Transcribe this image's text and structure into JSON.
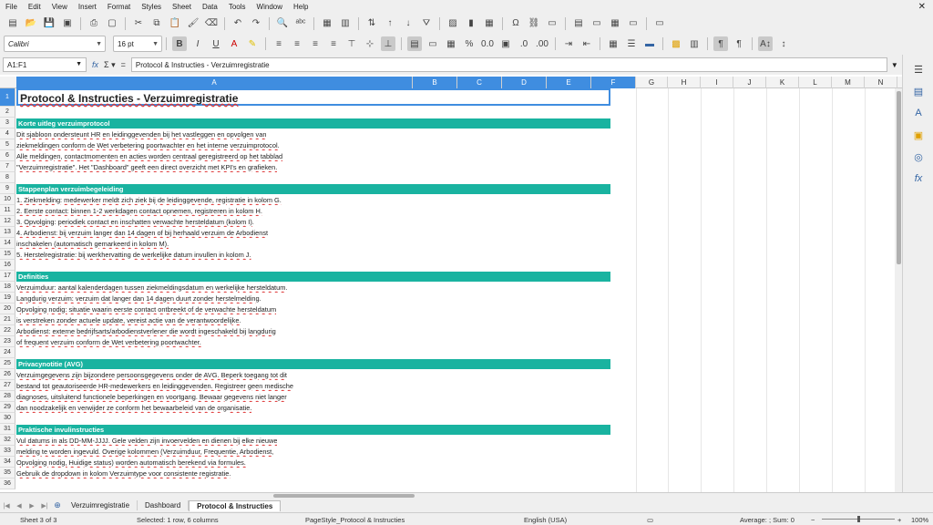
{
  "menu": [
    "File",
    "Edit",
    "View",
    "Insert",
    "Format",
    "Styles",
    "Sheet",
    "Data",
    "Tools",
    "Window",
    "Help"
  ],
  "toolbar": {
    "font_name": "Calibri",
    "font_size": "16 pt",
    "icons": [
      "new-icon",
      "open-icon",
      "save-icon",
      "export-pdf-icon",
      "print-icon",
      "print-preview-icon",
      "cut-icon",
      "copy-icon",
      "paste-icon",
      "clone-icon",
      "clear-icon",
      "undo-icon",
      "redo-icon",
      "find-icon",
      "spelling-icon",
      "row-icon",
      "column-icon",
      "sort-icon",
      "sort-asc-icon",
      "sort-desc-icon",
      "autofilter-icon",
      "image-icon",
      "chart-icon",
      "pivot-icon",
      "special-char-icon",
      "hyperlink-icon",
      "comment-icon",
      "header-footer-icon",
      "define-print-area-icon",
      "freeze-icon",
      "split-icon",
      "show-draw-icon"
    ]
  },
  "formula_bar": {
    "name_box": "A1:F1",
    "content": "Protocol & Instructies - Verzuimregistratie"
  },
  "columns": [
    "A",
    "B",
    "C",
    "D",
    "E",
    "F",
    "G",
    "H",
    "I",
    "J",
    "K",
    "L",
    "M",
    "N",
    "O"
  ],
  "rows": [
    {
      "n": "1",
      "type": "title",
      "text": "Protocol & Instructies - Verzuimregistratie"
    },
    {
      "n": "2",
      "type": "blank",
      "text": ""
    },
    {
      "n": "3",
      "type": "band",
      "text": "Korte uitleg verzuimprotocol"
    },
    {
      "n": "4",
      "type": "text",
      "text": "Dit sjabloon ondersteunt HR en leidinggevenden bij het vastleggen en opvolgen van"
    },
    {
      "n": "5",
      "type": "text",
      "text": "ziekmeldingen conform de Wet verbetering poortwachter en het interne verzuimprotocol."
    },
    {
      "n": "6",
      "type": "text",
      "text": "Alle meldingen, contactmomenten en acties worden centraal geregistreerd op het tabblad"
    },
    {
      "n": "7",
      "type": "text",
      "text": "\"Verzuimregistratie\". Het \"Dashboard\" geeft een direct overzicht met KPI's en grafieken."
    },
    {
      "n": "8",
      "type": "blank",
      "text": ""
    },
    {
      "n": "9",
      "type": "band",
      "text": "Stappenplan verzuimbegeleiding"
    },
    {
      "n": "10",
      "type": "text",
      "text": "1. Ziekmelding: medewerker meldt zich ziek bij de leidinggevende, registratie in kolom G."
    },
    {
      "n": "11",
      "type": "text",
      "text": "2. Eerste contact: binnen 1-2 werkdagen contact opnemen, registreren in kolom H."
    },
    {
      "n": "12",
      "type": "text",
      "text": "3. Opvolging: periodiek contact en inschatten verwachte hersteldatum (kolom I)."
    },
    {
      "n": "13",
      "type": "text",
      "text": "4. Arbodienst: bij verzuim langer dan 14 dagen of bij herhaald verzuim de Arbodienst"
    },
    {
      "n": "14",
      "type": "text",
      "text": "    inschakelen (automatisch gemarkeerd in kolom M)."
    },
    {
      "n": "15",
      "type": "text",
      "text": "5. Herstelregistratie: bij werkhervatting de werkelijke datum invullen in kolom J."
    },
    {
      "n": "16",
      "type": "blank",
      "text": ""
    },
    {
      "n": "17",
      "type": "band",
      "text": "Definities"
    },
    {
      "n": "18",
      "type": "text",
      "text": "Verzuimduur: aantal kalenderdagen tussen ziekmeldingsdatum en werkelijke hersteldatum."
    },
    {
      "n": "19",
      "type": "text",
      "text": "Langdurig verzuim: verzuim dat langer dan 14 dagen duurt zonder herstelmelding."
    },
    {
      "n": "20",
      "type": "text",
      "text": "Opvolging nodig: situatie waarin eerste contact ontbreekt of de verwachte hersteldatum"
    },
    {
      "n": "21",
      "type": "text",
      "text": "is verstreken zonder actuele update, vereist actie van de verantwoordelijke."
    },
    {
      "n": "22",
      "type": "text",
      "text": "Arbodienst: externe bedrijfsarts/arbodienstverlener die wordt ingeschakeld bij langdurig"
    },
    {
      "n": "23",
      "type": "text",
      "text": "of frequent verzuim conform de Wet verbetering poortwachter."
    },
    {
      "n": "24",
      "type": "blank",
      "text": ""
    },
    {
      "n": "25",
      "type": "band",
      "text": "Privacynotitie (AVG)"
    },
    {
      "n": "26",
      "type": "text",
      "text": "Verzuimgegevens zijn bijzondere persoonsgegevens onder de AVG. Beperk toegang tot dit"
    },
    {
      "n": "27",
      "type": "text",
      "text": "bestand tot geautoriseerde HR-medewerkers en leidinggevenden. Registreer geen medische"
    },
    {
      "n": "28",
      "type": "text",
      "text": "diagnoses, uitsluitend functionele beperkingen en voortgang. Bewaar gegevens niet langer"
    },
    {
      "n": "29",
      "type": "text",
      "text": "dan noodzakelijk en verwijder ze conform het bewaarbeleid van de organisatie."
    },
    {
      "n": "30",
      "type": "blank",
      "text": ""
    },
    {
      "n": "31",
      "type": "band",
      "text": "Praktische invulinstructies"
    },
    {
      "n": "32",
      "type": "text",
      "text": "Vul datums in als DD-MM-JJJJ. Gele velden zijn invoervelden en dienen bij elke nieuwe"
    },
    {
      "n": "33",
      "type": "text",
      "text": "melding te worden ingevuld. Overige kolommen (Verzuimduur, Frequentie, Arbodienst,"
    },
    {
      "n": "34",
      "type": "text",
      "text": "Opvolging nodig, Huidige status) worden automatisch berekend via formules."
    },
    {
      "n": "35",
      "type": "text",
      "text": "Gebruik de dropdown in kolom Verzuimtype voor consistente registratie."
    },
    {
      "n": "36",
      "type": "blank",
      "text": ""
    }
  ],
  "tabs": [
    "Verzuimregistratie",
    "Dashboard",
    "Protocol & Instructies"
  ],
  "active_tab": "Protocol & Instructies",
  "status": {
    "sheet": "Sheet 3 of 3",
    "selection": "Selected: 1 row, 6 columns",
    "page_style": "PageStyle_Protocol & Instructies",
    "language": "English (USA)",
    "summary": "Average: ; Sum: 0",
    "zoom": "100%"
  }
}
